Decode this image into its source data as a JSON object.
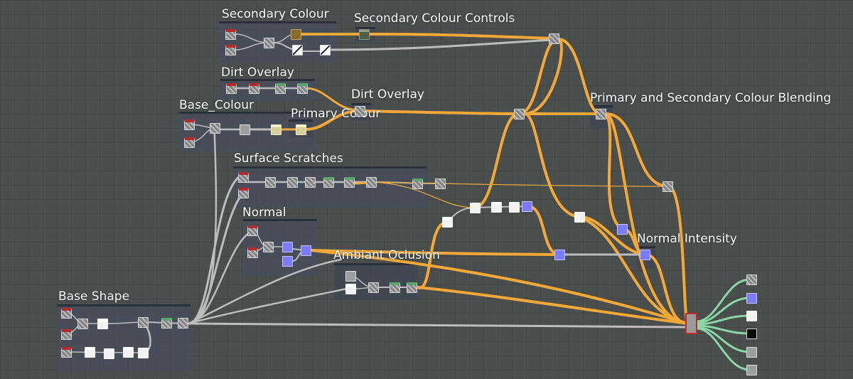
{
  "app": "Node Graph",
  "colors": {
    "wire_orange": "#f4a838",
    "wire_gray": "#bdbdbd",
    "wire_green": "#8ad6a6",
    "frame": "#464e60"
  },
  "frames": {
    "secondary_colour": "Secondary Colour",
    "dirt_overlay": "Dirt Overlay",
    "base_colour": "Base_Colour",
    "surface_scratches": "Surface Scratches",
    "normal": "Normal",
    "base_shape": "Base Shape"
  },
  "labels": {
    "secondary_colour_controls": "Secondary Colour Controls",
    "dirt_overlay_node": "Dirt Overlay",
    "primary_colour": "Primary Colour",
    "primary_secondary_blending": "Primary and Secondary Colour Blending",
    "normal_intensity": "Normal Intensity",
    "ambiant_oclusion": "Ambiant Oclusion"
  },
  "output_nodes": [
    "base-color-output",
    "normal-output",
    "roughness-output",
    "metallic-output",
    "height-output",
    "ambient-occlusion-output"
  ]
}
